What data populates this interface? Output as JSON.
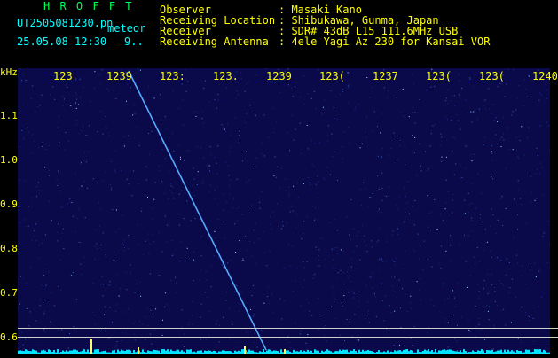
{
  "header": {
    "logo": "H R O F F T",
    "filename": "UT2505081230.pn",
    "event_label": "meteor",
    "datetime": "25.05.08 12:30",
    "extra": "9..",
    "info_labels": [
      "Observer",
      "Receiving Location",
      "Receiver",
      "Receiving Antenna"
    ],
    "info_values": [
      ": Masaki Kano",
      ": Shibukawa, Gunma, Japan",
      ": SDR# 43dB L15 111.6MHz USB",
      ": 4ele Yagi Az 230 for Kansai VOR"
    ]
  },
  "axis": {
    "unit": "kHz",
    "y_ticks": [
      "1.1",
      "1.0",
      "0.9",
      "0.8",
      "0.7",
      "0.6"
    ],
    "x_ticks": [
      "123",
      "1239",
      "123:",
      "123.",
      "1239",
      "123(",
      "1237",
      "123(",
      "123(",
      "1240"
    ]
  },
  "colors": {
    "background": "#0a0a4a",
    "meteor_trail": "#55aaff",
    "text": "#ffff00",
    "logo": "#00ff55"
  }
}
